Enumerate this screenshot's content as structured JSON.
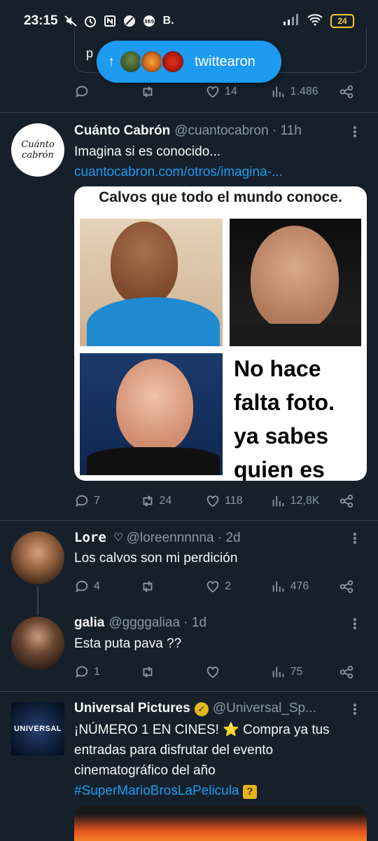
{
  "status_bar": {
    "time": "23:15",
    "left_icons": [
      "mute-icon",
      "alarm-icon",
      "nfc-icon",
      "slash-icon",
      "app-icon",
      "b-icon"
    ],
    "app_badge": "B.",
    "battery": "24"
  },
  "new_tweets_pill": {
    "label": "twittearon",
    "arrow": "↑"
  },
  "previous_tweet": {
    "quote_text": "p",
    "replies": "",
    "retweets": "",
    "likes": "14",
    "views": "1.486"
  },
  "tweets": [
    {
      "name": "Cuánto Cabrón",
      "handle": "@cuantocabron · 11h",
      "text": "Imagina si es conocido...",
      "link": "cuantocabron.com/otros/imagina-...",
      "avatar_text": "Cuánto cabrón",
      "meme": {
        "title": "Calvos que todo el mundo conoce.",
        "caption_lines": [
          "No hace",
          "falta foto.",
          " ya sabes",
          "quien es"
        ]
      },
      "replies": "7",
      "retweets": "24",
      "likes": "118",
      "views": "12,8K"
    },
    {
      "name": "Lore ♡",
      "handle": "@loreennnnna · 2d",
      "text": "Los calvos son mi perdición",
      "replies": "4",
      "retweets": "",
      "likes": "2",
      "views": "476"
    },
    {
      "name": "galia",
      "handle": "@ggggaliaa · 1d",
      "text": "Esta puta pava ??",
      "replies": "1",
      "retweets": "",
      "likes": "",
      "views": "75"
    },
    {
      "name": "Universal Pictures",
      "handle": "@Universal_Sp...",
      "avatar_text": "UNIVERSAL",
      "text_lines": [
        "¡NÚMERO 1 EN CINES! ⭐ Compra ya tus",
        "entradas para disfrutar del evento",
        "cinematográfico del año"
      ],
      "hashtag": "#SuperMarioBrosLaPelicula",
      "emoji": "?"
    }
  ],
  "more_label": "⋮",
  "colors": {
    "background": "#15202b",
    "accent": "#1d9bf0",
    "muted": "#8b98a5",
    "divider": "#38444d"
  }
}
